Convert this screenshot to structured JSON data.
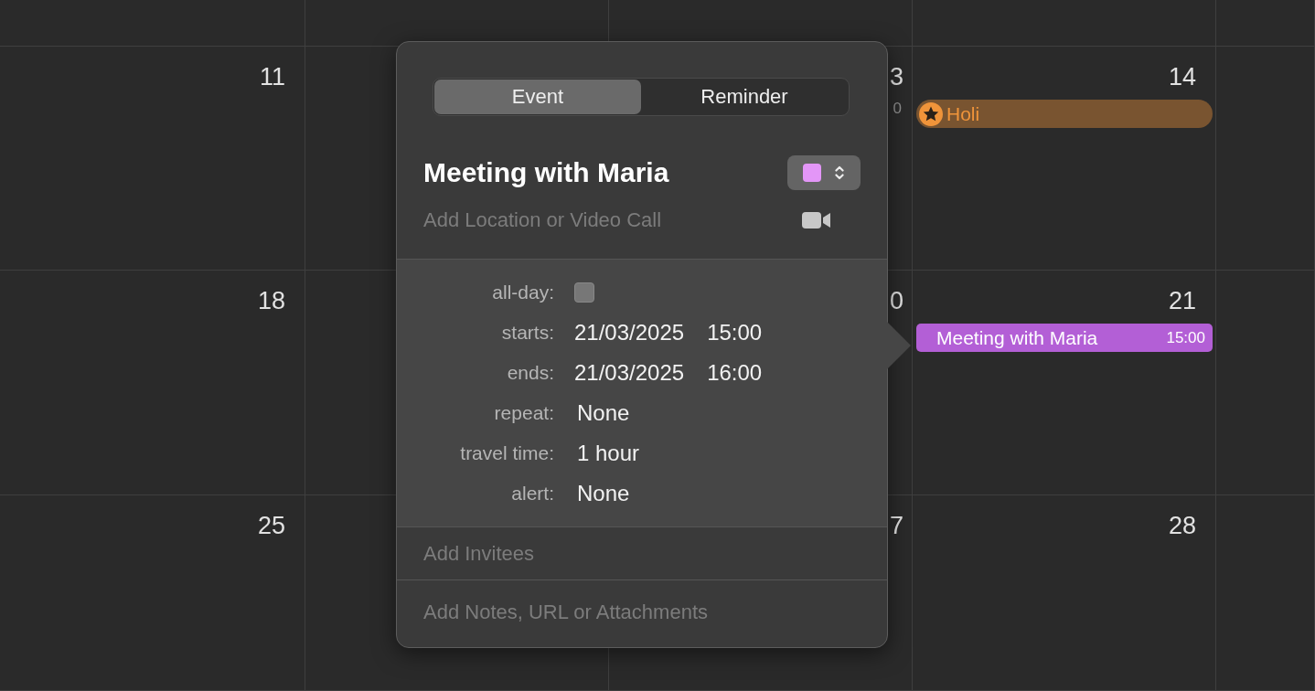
{
  "calendar": {
    "weeks": [
      {
        "days": [
          {
            "day": "11"
          },
          {
            "day": "3",
            "events": [
              {
                "kind": "fragment",
                "time": "0"
              }
            ]
          },
          {
            "day": "14",
            "events": [
              {
                "kind": "holiday",
                "title": "Holi",
                "color": "#f0943a"
              }
            ]
          }
        ]
      },
      {
        "days": [
          {
            "day": "18"
          },
          {
            "day": "0"
          },
          {
            "day": "21",
            "events": [
              {
                "kind": "timed",
                "title": "Meeting with Maria",
                "time": "15:00",
                "color": "#b35fd6"
              }
            ]
          }
        ]
      },
      {
        "days": [
          {
            "day": "25"
          },
          {
            "day": "7"
          },
          {
            "day": "28"
          }
        ]
      }
    ]
  },
  "popover": {
    "segments": [
      {
        "label": "Event",
        "selected": true
      },
      {
        "label": "Reminder",
        "selected": false
      }
    ],
    "title": "Meeting with Maria",
    "location_placeholder": "Add Location or Video Call",
    "details": [
      {
        "kind": "checkbox",
        "label": "all-day:",
        "checked": false
      },
      {
        "kind": "datetime",
        "label": "starts:",
        "date": "21/03/2025",
        "time": "15:00"
      },
      {
        "kind": "datetime",
        "label": "ends:",
        "date": "21/03/2025",
        "time": "16:00"
      },
      {
        "kind": "value",
        "label": "repeat:",
        "value": "None"
      },
      {
        "kind": "value",
        "label": "travel time:",
        "value": "1 hour"
      },
      {
        "kind": "value",
        "label": "alert:",
        "value": "None"
      }
    ],
    "invitees_placeholder": "Add Invitees",
    "notes_placeholder": "Add Notes, URL or Attachments"
  }
}
